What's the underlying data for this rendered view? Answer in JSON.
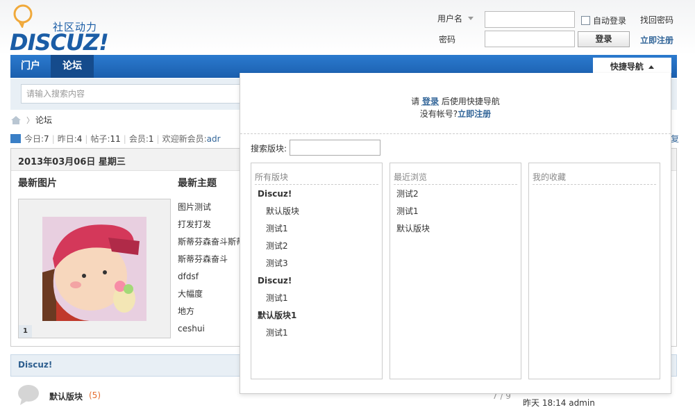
{
  "header": {
    "slogan": "社区动力",
    "brand": "DISCUZ!",
    "login": {
      "username_label": "用户名",
      "password_label": "密码",
      "auto_login_label": "自动登录",
      "find_password": "找回密码",
      "login_button": "登录",
      "register": "立即注册"
    }
  },
  "nav": {
    "items": [
      {
        "label": "门户"
      },
      {
        "label": "论坛"
      }
    ],
    "quick_nav_label": "快捷导航"
  },
  "search": {
    "placeholder": "请输入搜索内容"
  },
  "breadcrumb": {
    "current": "论坛"
  },
  "stats": {
    "today_label": "今日:",
    "today": "7",
    "yesterday_label": "昨日:",
    "yesterday": "4",
    "posts_label": "帖子:",
    "posts": "11",
    "members_label": "会员:",
    "members": "1",
    "welcome_label": "欢迎新会员:",
    "welcome_user": "adr",
    "tail": "复"
  },
  "panel": {
    "date": "2013年03月06日  星期三",
    "col_photos": "最新图片",
    "col_topics": "最新主题",
    "photo_index": "1",
    "topics": [
      "图片测试",
      "打发打发",
      "斯蒂芬森奋斗斯蒂",
      "斯蒂芬森奋斗",
      "dfdsf",
      "大幅度",
      "地方",
      "ceshui"
    ]
  },
  "category": {
    "title": "Discuz!",
    "forum": {
      "name": "默认版块",
      "count": "(5)",
      "ratio": "7 / 9",
      "last": "昨天 18:14 admin"
    }
  },
  "quick_nav": {
    "msg_prefix": "请",
    "login_link": "登录",
    "msg_suffix": "后使用快捷导航",
    "no_account": "没有帐号?",
    "register_link": "立即注册",
    "search_label": "搜索版块:",
    "all_boards": {
      "title": "所有版块",
      "items": [
        {
          "label": "Discuz!",
          "kind": "grp"
        },
        {
          "label": "默认版块",
          "kind": "sub"
        },
        {
          "label": "测试1",
          "kind": "sub"
        },
        {
          "label": "测试2",
          "kind": "sub"
        },
        {
          "label": "测试3",
          "kind": "sub"
        },
        {
          "label": "Discuz!",
          "kind": "grp"
        },
        {
          "label": "测试1",
          "kind": "sub"
        },
        {
          "label": "默认版块1",
          "kind": "grp"
        },
        {
          "label": "测试1",
          "kind": "sub"
        }
      ]
    },
    "recent": {
      "title": "最近浏览",
      "items": [
        "测试2",
        "测试1",
        "默认版块"
      ]
    },
    "favorites": {
      "title": "我的收藏"
    }
  },
  "colors": {
    "nav_blue": "#1b5fae",
    "link_blue": "#336699",
    "count_orange": "#e56a2c"
  }
}
